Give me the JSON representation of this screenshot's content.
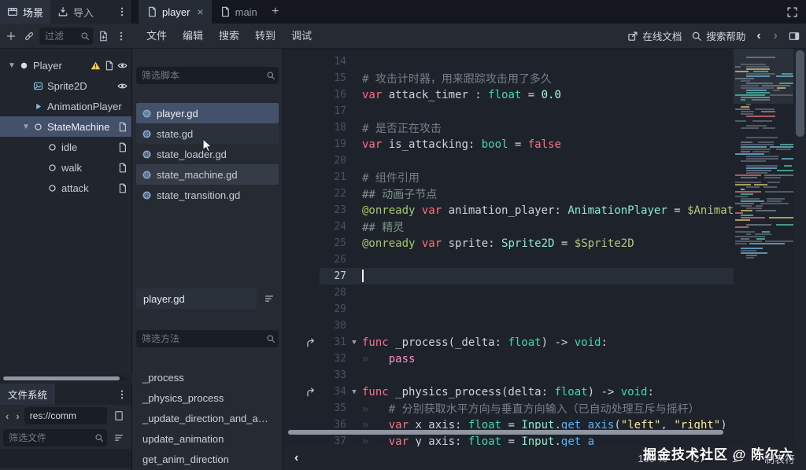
{
  "topbar": {
    "dock_tabs": [
      {
        "label": "场景",
        "icon": "scene",
        "active": true
      },
      {
        "label": "导入",
        "icon": "import",
        "active": false
      }
    ],
    "script_tabs": [
      {
        "label": "player",
        "icon": "script",
        "active": true,
        "closable": true
      },
      {
        "label": "main",
        "icon": "script",
        "active": false,
        "closable": false
      }
    ]
  },
  "menubar": {
    "menus": [
      "文件",
      "编辑",
      "搜索",
      "转到",
      "调试"
    ],
    "online_docs": "在线文档",
    "search_help": "搜索帮助"
  },
  "scene_dock": {
    "filter_placeholder": "过滤",
    "nodes": [
      {
        "name": "Player",
        "depth": 0,
        "icon": "node-circle",
        "expanded": true,
        "selected": false,
        "badges": [
          "warning",
          "script",
          "eye"
        ]
      },
      {
        "name": "Sprite2D",
        "depth": 1,
        "icon": "image",
        "expanded": false,
        "selected": false,
        "badges": [
          "eye"
        ]
      },
      {
        "name": "AnimationPlayer",
        "depth": 1,
        "icon": "play",
        "expanded": false,
        "selected": false,
        "badges": []
      },
      {
        "name": "StateMachine",
        "depth": 1,
        "icon": "circle",
        "expanded": true,
        "selected": true,
        "badges": [
          "script"
        ]
      },
      {
        "name": "idle",
        "depth": 2,
        "icon": "circle",
        "expanded": false,
        "selected": false,
        "badges": [
          "script"
        ]
      },
      {
        "name": "walk",
        "depth": 2,
        "icon": "circle",
        "expanded": false,
        "selected": false,
        "badges": [
          "script"
        ]
      },
      {
        "name": "attack",
        "depth": 2,
        "icon": "circle",
        "expanded": false,
        "selected": false,
        "badges": [
          "script"
        ]
      }
    ]
  },
  "scripts_panel": {
    "filter_scripts_placeholder": "筛选脚本",
    "scripts": [
      {
        "name": "player.gd",
        "state": "selected"
      },
      {
        "name": "state.gd",
        "state": "subtle"
      },
      {
        "name": "state_loader.gd",
        "state": ""
      },
      {
        "name": "state_machine.gd",
        "state": "hover"
      },
      {
        "name": "state_transition.gd",
        "state": ""
      }
    ],
    "current_script": "player.gd",
    "filter_methods_placeholder": "筛选方法",
    "methods": [
      "_process",
      "_physics_process",
      "_update_direction_and_ani...",
      "update_animation",
      "get_anim_direction"
    ]
  },
  "filesystem": {
    "title": "文件系统",
    "path": "res://comm",
    "filter_placeholder": "筛选文件"
  },
  "editor": {
    "lines": [
      {
        "n": 14,
        "tokens": []
      },
      {
        "n": 15,
        "tokens": [
          {
            "t": "# 攻击计时器，用来跟踪攻击用了多久",
            "c": "com"
          }
        ]
      },
      {
        "n": 16,
        "tokens": [
          {
            "t": "var",
            "c": "kw"
          },
          {
            "t": " attack_timer : ",
            "c": "pl"
          },
          {
            "t": "float",
            "c": "type"
          },
          {
            "t": " = ",
            "c": "pl"
          },
          {
            "t": "0.0",
            "c": "num"
          }
        ]
      },
      {
        "n": 17,
        "tokens": []
      },
      {
        "n": 18,
        "tokens": [
          {
            "t": "# 是否正在攻击",
            "c": "com"
          }
        ]
      },
      {
        "n": 19,
        "tokens": [
          {
            "t": "var",
            "c": "kw"
          },
          {
            "t": " is_attacking: ",
            "c": "pl"
          },
          {
            "t": "bool",
            "c": "type"
          },
          {
            "t": " = ",
            "c": "pl"
          },
          {
            "t": "false",
            "c": "kw"
          }
        ]
      },
      {
        "n": 20,
        "tokens": []
      },
      {
        "n": 21,
        "tokens": [
          {
            "t": "# 组件引用",
            "c": "com"
          }
        ]
      },
      {
        "n": 22,
        "tokens": [
          {
            "t": "## 动画子节点",
            "c": "doc"
          }
        ]
      },
      {
        "n": 23,
        "tokens": [
          {
            "t": "@onready",
            "c": "ann"
          },
          {
            "t": " ",
            "c": "pl"
          },
          {
            "t": "var",
            "c": "kw"
          },
          {
            "t": " animation_player: ",
            "c": "pl"
          },
          {
            "t": "AnimationPlayer",
            "c": "ctype"
          },
          {
            "t": " = ",
            "c": "pl"
          },
          {
            "t": "$Animation",
            "c": "node"
          }
        ]
      },
      {
        "n": 24,
        "tokens": [
          {
            "t": "## 精灵",
            "c": "doc"
          }
        ]
      },
      {
        "n": 25,
        "tokens": [
          {
            "t": "@onready",
            "c": "ann"
          },
          {
            "t": " ",
            "c": "pl"
          },
          {
            "t": "var",
            "c": "kw"
          },
          {
            "t": " sprite: ",
            "c": "pl"
          },
          {
            "t": "Sprite2D",
            "c": "ctype"
          },
          {
            "t": " = ",
            "c": "pl"
          },
          {
            "t": "$Sprite2D",
            "c": "node"
          }
        ]
      },
      {
        "n": 26,
        "tokens": []
      },
      {
        "n": 27,
        "tokens": [],
        "current": true,
        "caret": true
      },
      {
        "n": 28,
        "tokens": []
      },
      {
        "n": 29,
        "tokens": []
      },
      {
        "n": 30,
        "tokens": []
      },
      {
        "n": 31,
        "fold": true,
        "override": true,
        "tokens": [
          {
            "t": "func",
            "c": "kw"
          },
          {
            "t": " _process(_delta: ",
            "c": "pl"
          },
          {
            "t": "float",
            "c": "type"
          },
          {
            "t": ") -> ",
            "c": "pl"
          },
          {
            "t": "void",
            "c": "type"
          },
          {
            "t": ":",
            "c": "pl"
          }
        ]
      },
      {
        "n": 32,
        "tokens": [
          {
            "t": "»   ",
            "c": "ws"
          },
          {
            "t": "pass",
            "c": "ctrl"
          }
        ]
      },
      {
        "n": 33,
        "tokens": []
      },
      {
        "n": 34,
        "fold": true,
        "override": true,
        "tokens": [
          {
            "t": "func",
            "c": "kw"
          },
          {
            "t": " _physics_process(delta: ",
            "c": "pl"
          },
          {
            "t": "float",
            "c": "type"
          },
          {
            "t": ") -> ",
            "c": "pl"
          },
          {
            "t": "void",
            "c": "type"
          },
          {
            "t": ":",
            "c": "pl"
          }
        ]
      },
      {
        "n": 35,
        "tokens": [
          {
            "t": "»   ",
            "c": "ws"
          },
          {
            "t": "# 分别获取水平方向与垂直方向输入（已自动处理互斥与摇杆）",
            "c": "com"
          }
        ]
      },
      {
        "n": 36,
        "tokens": [
          {
            "t": "»   ",
            "c": "ws"
          },
          {
            "t": "var",
            "c": "kw"
          },
          {
            "t": " x_axis: ",
            "c": "pl"
          },
          {
            "t": "float",
            "c": "type"
          },
          {
            "t": " = ",
            "c": "pl"
          },
          {
            "t": "Input",
            "c": "ctype"
          },
          {
            "t": ".",
            "c": "pl"
          },
          {
            "t": "get_axis",
            "c": "fn"
          },
          {
            "t": "(",
            "c": "pl"
          },
          {
            "t": "\"left\"",
            "c": "str"
          },
          {
            "t": ", ",
            "c": "pl"
          },
          {
            "t": "\"right\"",
            "c": "str"
          },
          {
            "t": ")",
            "c": "pl"
          }
        ]
      },
      {
        "n": 37,
        "tokens": [
          {
            "t": "»   ",
            "c": "ws"
          },
          {
            "t": "var",
            "c": "kw"
          },
          {
            "t": " y_axis: ",
            "c": "pl"
          },
          {
            "t": "float",
            "c": "type"
          },
          {
            "t": " = ",
            "c": "pl"
          },
          {
            "t": "Input",
            "c": "ctype"
          },
          {
            "t": ".",
            "c": "pl"
          },
          {
            "t": "get_a",
            "c": "fn"
          }
        ]
      }
    ],
    "status": {
      "zoom": "100 %",
      "line": "27",
      "column": "1",
      "indent_label": "制表符"
    }
  },
  "watermark": "掘金技术社区 @ 陈尔六",
  "colors": {
    "selection": "#44516a",
    "keyword": "#ff7085",
    "type": "#45d7ae",
    "string": "#ffe79a",
    "comment": "#767e8a",
    "accent_blue": "#5fb0e8",
    "warning_yellow": "#ffd04c"
  }
}
